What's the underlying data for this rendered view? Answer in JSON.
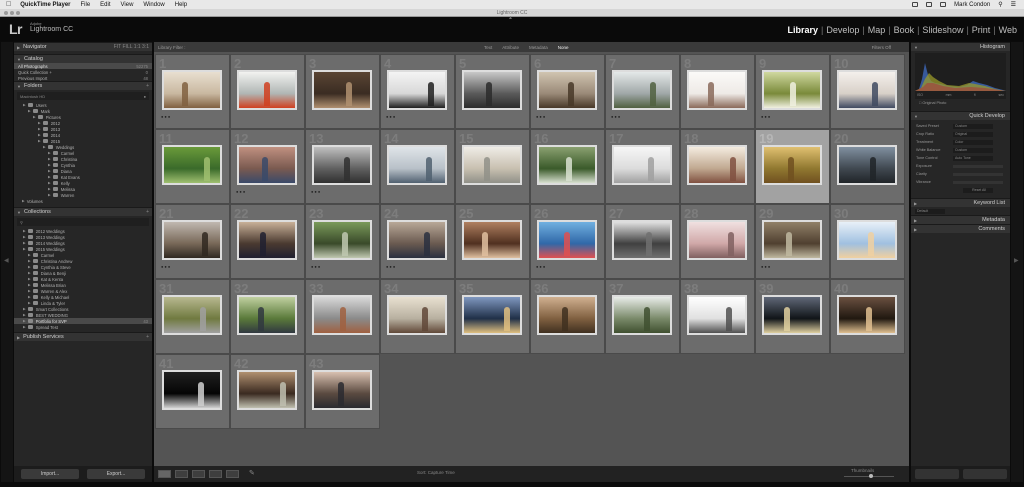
{
  "menubar": {
    "items": [
      "QuickTime Player",
      "File",
      "Edit",
      "View",
      "Window",
      "Help"
    ],
    "user": "Mark Condon"
  },
  "window": {
    "title": "Lightroom CC"
  },
  "lightroom": {
    "logo": "Lr",
    "adobe": "Adobe",
    "product": "Lightroom CC",
    "modules": [
      "Library",
      "Develop",
      "Map",
      "Book",
      "Slideshow",
      "Print",
      "Web"
    ],
    "active_module": "Library"
  },
  "left_panel": {
    "navigator": "Navigator",
    "catalog_title": "Catalog",
    "catalog": [
      {
        "label": "All Photographs",
        "count": "52275",
        "selected": true
      },
      {
        "label": "Quick Collection +",
        "count": "0",
        "selected": false
      },
      {
        "label": "Previous Import",
        "count": "48",
        "selected": false
      }
    ],
    "folders_title": "Folders",
    "volume_label": "Macintosh HD",
    "folders": [
      {
        "label": "Users",
        "count": "",
        "indent": 1
      },
      {
        "label": "Mark",
        "count": "",
        "indent": 2
      },
      {
        "label": "Pictures",
        "count": "",
        "indent": 3
      },
      {
        "label": "2012",
        "count": "",
        "indent": 4
      },
      {
        "label": "2013",
        "count": "",
        "indent": 4
      },
      {
        "label": "2014",
        "count": "",
        "indent": 4
      },
      {
        "label": "2015",
        "count": "",
        "indent": 4
      },
      {
        "label": "Weddings",
        "count": "",
        "indent": 5
      },
      {
        "label": "Carmel",
        "count": "",
        "indent": 6
      },
      {
        "label": "Christina",
        "count": "",
        "indent": 6
      },
      {
        "label": "Cynthia",
        "count": "",
        "indent": 6
      },
      {
        "label": "Diana",
        "count": "",
        "indent": 6
      },
      {
        "label": "Kat Evans",
        "count": "",
        "indent": 6
      },
      {
        "label": "Kelly",
        "count": "",
        "indent": 6
      },
      {
        "label": "Melissa",
        "count": "",
        "indent": 6
      },
      {
        "label": "Warren",
        "count": "",
        "indent": 6
      }
    ],
    "volumes_label": "Volumes",
    "collections_title": "Collections",
    "collections": [
      {
        "label": "2012 Weddings",
        "count": "",
        "indent": 1,
        "selected": false
      },
      {
        "label": "2013 Weddings",
        "count": "",
        "indent": 1,
        "selected": false
      },
      {
        "label": "2014 Weddings",
        "count": "",
        "indent": 1,
        "selected": false
      },
      {
        "label": "2015 Weddings",
        "count": "",
        "indent": 1,
        "selected": false
      },
      {
        "label": "Carmel",
        "count": "",
        "indent": 2,
        "selected": false
      },
      {
        "label": "Christina Andrew",
        "count": "",
        "indent": 2,
        "selected": false
      },
      {
        "label": "Cynthia & Steve",
        "count": "",
        "indent": 2,
        "selected": false
      },
      {
        "label": "Diana & Benji",
        "count": "",
        "indent": 2,
        "selected": false
      },
      {
        "label": "Kat & Kenta",
        "count": "",
        "indent": 2,
        "selected": false
      },
      {
        "label": "Melissa Brian",
        "count": "",
        "indent": 2,
        "selected": false
      },
      {
        "label": "Warren & Alex",
        "count": "",
        "indent": 2,
        "selected": false
      },
      {
        "label": "Kelly & Michael",
        "count": "",
        "indent": 2,
        "selected": false
      },
      {
        "label": "Linda & Tyler",
        "count": "",
        "indent": 2,
        "selected": false
      },
      {
        "label": "Smart Collections",
        "count": "",
        "indent": 1,
        "selected": false
      },
      {
        "label": "BEST WEDDING",
        "count": "",
        "indent": 1,
        "selected": false
      },
      {
        "label": "Portfolio for SVP",
        "count": "43",
        "indent": 1,
        "selected": true
      },
      {
        "label": "Spread Test",
        "count": "",
        "indent": 1,
        "selected": false
      }
    ],
    "publish_title": "Publish Services",
    "import_label": "Import...",
    "export_label": "Export..."
  },
  "filter_bar": {
    "label": "Library Filter :",
    "tabs": [
      "Text",
      "Attribute",
      "Metadata",
      "None"
    ],
    "active_tab": "None",
    "right": "Filters Off"
  },
  "grid": {
    "selected_index": 19,
    "cells": [
      {
        "n": "1",
        "rating": 3
      },
      {
        "n": "2",
        "rating": 0
      },
      {
        "n": "3",
        "rating": 0
      },
      {
        "n": "4",
        "rating": 3
      },
      {
        "n": "5",
        "rating": 0
      },
      {
        "n": "6",
        "rating": 3
      },
      {
        "n": "7",
        "rating": 3
      },
      {
        "n": "8",
        "rating": 0
      },
      {
        "n": "9",
        "rating": 3
      },
      {
        "n": "10",
        "rating": 0
      },
      {
        "n": "11",
        "rating": 0
      },
      {
        "n": "12",
        "rating": 3
      },
      {
        "n": "13",
        "rating": 3
      },
      {
        "n": "14",
        "rating": 0
      },
      {
        "n": "15",
        "rating": 0
      },
      {
        "n": "16",
        "rating": 0
      },
      {
        "n": "17",
        "rating": 0
      },
      {
        "n": "18",
        "rating": 0
      },
      {
        "n": "19",
        "rating": 0
      },
      {
        "n": "20",
        "rating": 0
      },
      {
        "n": "21",
        "rating": 3
      },
      {
        "n": "22",
        "rating": 0
      },
      {
        "n": "23",
        "rating": 3
      },
      {
        "n": "24",
        "rating": 3
      },
      {
        "n": "25",
        "rating": 0
      },
      {
        "n": "26",
        "rating": 3
      },
      {
        "n": "27",
        "rating": 0
      },
      {
        "n": "28",
        "rating": 0
      },
      {
        "n": "29",
        "rating": 3
      },
      {
        "n": "30",
        "rating": 0
      },
      {
        "n": "31",
        "rating": 0
      },
      {
        "n": "32",
        "rating": 0
      },
      {
        "n": "33",
        "rating": 0
      },
      {
        "n": "34",
        "rating": 0
      },
      {
        "n": "35",
        "rating": 0
      },
      {
        "n": "36",
        "rating": 0
      },
      {
        "n": "37",
        "rating": 0
      },
      {
        "n": "38",
        "rating": 0
      },
      {
        "n": "39",
        "rating": 0
      },
      {
        "n": "40",
        "rating": 0
      },
      {
        "n": "41",
        "rating": 0
      },
      {
        "n": "42",
        "rating": 0
      },
      {
        "n": "43",
        "rating": 0
      }
    ]
  },
  "toolbar": {
    "sort_label": "Sort:",
    "sort_value": "Capture Time",
    "thumbnails_label": "Thumbnails"
  },
  "right_panel": {
    "histogram_title": "Histogram",
    "histogram_values": [
      "ISO",
      "mm",
      "f/",
      "sec"
    ],
    "original_photo": "Original Photo",
    "quick_develop_title": "Quick Develop",
    "qd_rows": [
      {
        "label": "Saved Preset",
        "value": "Custom"
      },
      {
        "label": "Crop Ratio",
        "value": "Original"
      },
      {
        "label": "Treatment",
        "value": "Color"
      },
      {
        "label": "White Balance",
        "value": "Custom"
      },
      {
        "label": "Tone Control",
        "value": "Auto Tone"
      },
      {
        "label": "Exposure",
        "value": ""
      },
      {
        "label": "Clarity",
        "value": ""
      },
      {
        "label": "Vibrance",
        "value": ""
      }
    ],
    "reset_all": "Reset All",
    "keyword_list": "Keyword List",
    "keywording_label": "Default",
    "metadata": "Metadata",
    "comments": "Comments"
  }
}
